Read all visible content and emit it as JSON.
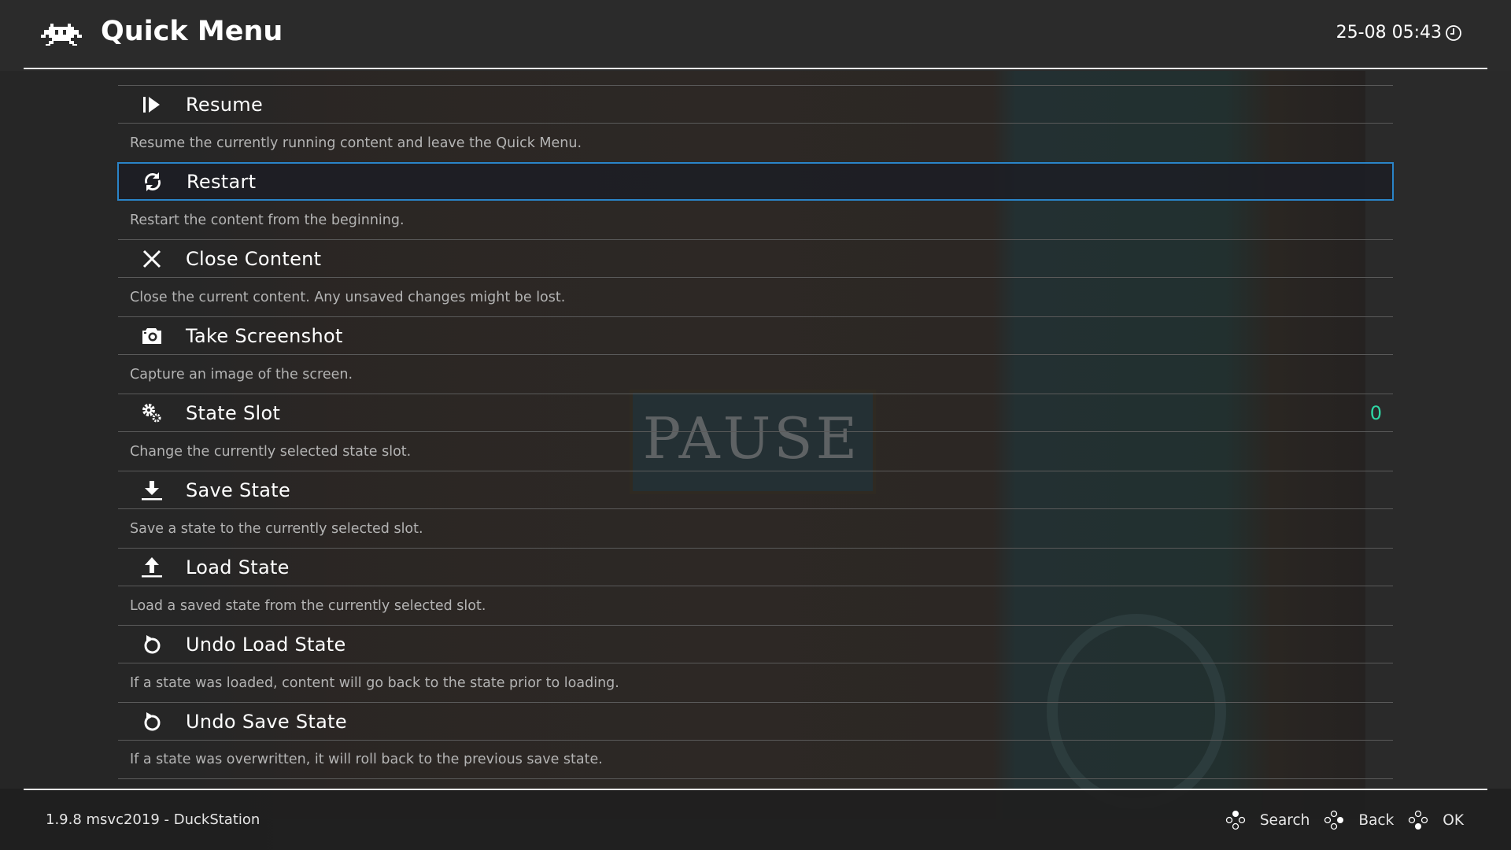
{
  "header": {
    "title": "Quick Menu",
    "datetime": "25-08 05:43"
  },
  "background": {
    "game_text": "PAUSE"
  },
  "menu": {
    "items": [
      {
        "label": "Resume",
        "icon": "resume-icon",
        "description": "Resume the currently running content and leave the Quick Menu."
      },
      {
        "label": "Restart",
        "icon": "restart-icon",
        "description": "Restart the content from the beginning.",
        "selected": true
      },
      {
        "label": "Close Content",
        "icon": "close-icon",
        "description": "Close the current content. Any unsaved changes might be lost."
      },
      {
        "label": "Take Screenshot",
        "icon": "camera-icon",
        "description": "Capture an image of the screen."
      },
      {
        "label": "State Slot",
        "icon": "gears-icon",
        "value": "0",
        "description": "Change the currently selected state slot."
      },
      {
        "label": "Save State",
        "icon": "download-icon",
        "description": "Save a state to the currently selected slot."
      },
      {
        "label": "Load State",
        "icon": "upload-icon",
        "description": "Load a saved state from the currently selected slot."
      },
      {
        "label": "Undo Load State",
        "icon": "undo-icon",
        "description": "If a state was loaded, content will go back to the state prior to loading."
      },
      {
        "label": "Undo Save State",
        "icon": "undo-icon",
        "description": "If a state was overwritten, it will roll back to the previous save state."
      }
    ]
  },
  "footer": {
    "version": "1.9.8 msvc2019 - DuckStation",
    "hints": [
      {
        "label": "Search",
        "icon": "gamepad-top-button-icon"
      },
      {
        "label": "Back",
        "icon": "gamepad-right-button-icon"
      },
      {
        "label": "OK",
        "icon": "gamepad-bottom-button-icon"
      }
    ]
  },
  "colors": {
    "accent": "#2a84c8",
    "value": "#2fd8a6",
    "background": "#2a2a2a"
  }
}
